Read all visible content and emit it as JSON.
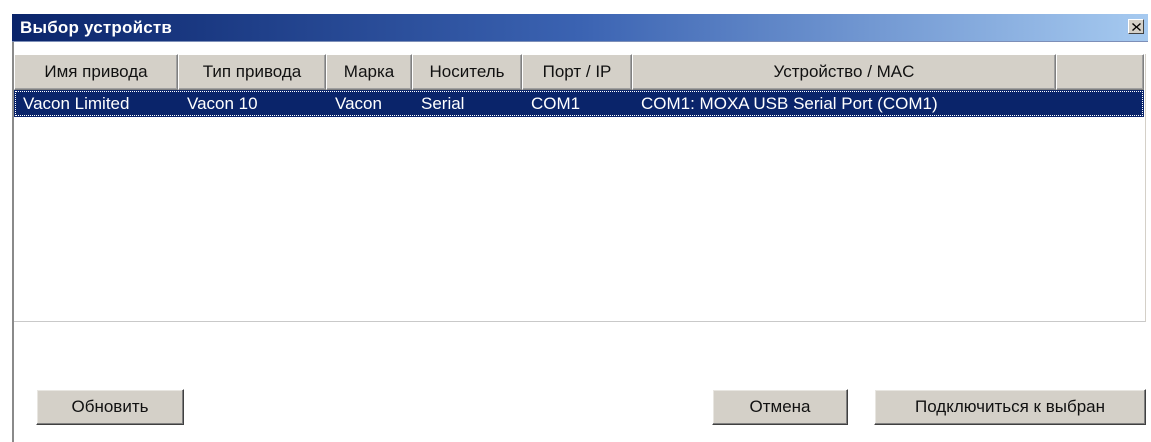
{
  "window": {
    "title": "Выбор устройств"
  },
  "grid": {
    "columns": [
      "Имя привода",
      "Тип привода",
      "Марка",
      "Носитель",
      "Порт / IP",
      "Устройство / MAC",
      ""
    ],
    "rows": [
      {
        "cells": [
          "Vacon Limited",
          "Vacon 10",
          "Vacon",
          "Serial",
          "COM1",
          "COM1: MOXA USB Serial Port (COM1)",
          ""
        ],
        "selected": true
      }
    ]
  },
  "buttons": {
    "refresh": "Обновить",
    "cancel": "Отмена",
    "connect": "Подключиться к выбран"
  },
  "colors": {
    "title_gradient_start": "#0a246a",
    "title_gradient_end": "#a6caf0",
    "selection": "#0a246a",
    "face": "#d4d0c8"
  },
  "icons": {
    "close": "close-icon"
  }
}
